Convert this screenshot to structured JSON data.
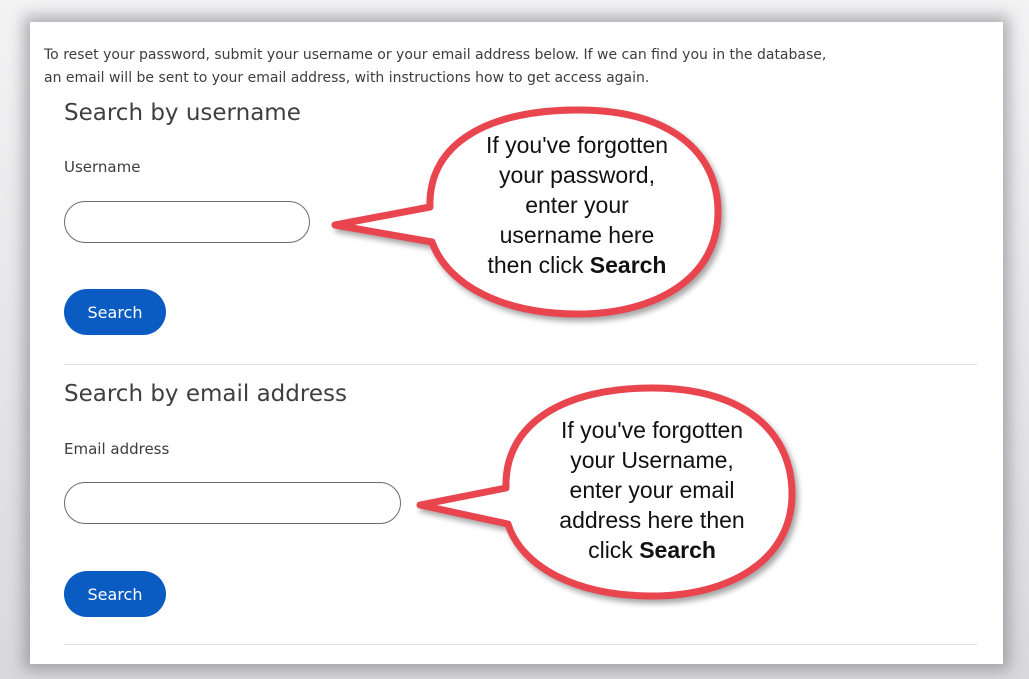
{
  "intro": {
    "line1": "To reset your password, submit your username or your email address below.  If we can find you in the database,",
    "line2": "an email will be sent to your email address, with instructions how to get access again."
  },
  "username_section": {
    "title": "Search by username",
    "field_label": "Username",
    "input_value": "",
    "button_label": "Search"
  },
  "email_section": {
    "title": "Search by email address",
    "field_label": "Email address",
    "input_value": "",
    "button_label": "Search"
  },
  "callout_username": {
    "lines": [
      "If you've forgotten",
      "your password,",
      "enter your",
      "username here",
      "then click "
    ],
    "bold_word": "Search"
  },
  "callout_email": {
    "lines": [
      "If you've forgotten",
      "your Username,",
      "enter your email",
      "address here then",
      "click "
    ],
    "bold_word": "Search"
  },
  "colors": {
    "accent": "#0a5bc2",
    "callout_border": "#e8454f"
  }
}
